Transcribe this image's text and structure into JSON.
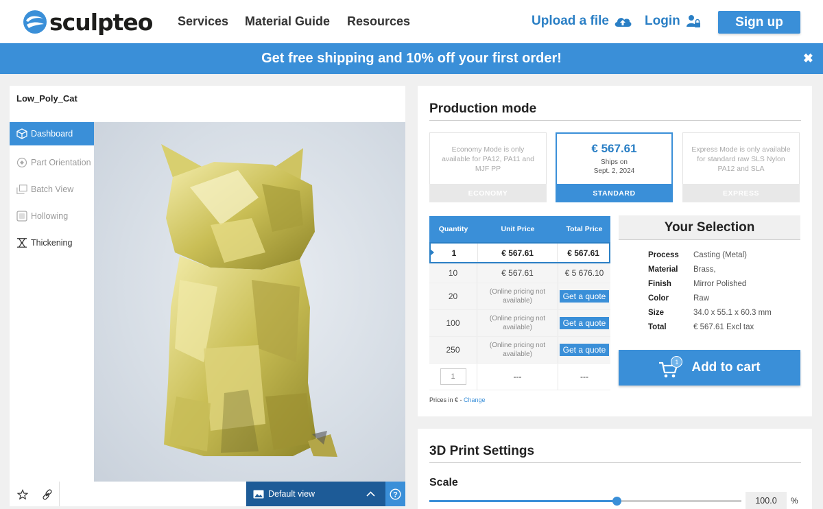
{
  "brand": {
    "name": "sculpteo",
    "color": "#3a8fd8"
  },
  "nav": {
    "items": [
      "Services",
      "Material Guide",
      "Resources"
    ],
    "upload_label": "Upload a file",
    "login_label": "Login",
    "signup_label": "Sign up"
  },
  "promo": {
    "text": "Get free shipping and 10% off your first order!",
    "close": "✖"
  },
  "part": {
    "name": "Low_Poly_Cat"
  },
  "sidebar": {
    "items": [
      {
        "label": "Dashboard",
        "icon": "cube-icon"
      },
      {
        "label": "Part Orientation",
        "icon": "orientation-icon"
      },
      {
        "label": "Batch View",
        "icon": "batch-icon"
      },
      {
        "label": "Hollowing",
        "icon": "hollowing-icon"
      },
      {
        "label": "Thickening",
        "icon": "thickening-icon"
      }
    ]
  },
  "viewer": {
    "view_label": "Default view",
    "help": "?"
  },
  "production": {
    "title": "Production mode",
    "modes": [
      {
        "label": "ECONOMY",
        "note": "Economy Mode is only available for PA12, PA11 and MJF PP"
      },
      {
        "label": "STANDARD",
        "price": "€ 567.61",
        "ships_label": "Ships on",
        "ships_date": "Sept. 2, 2024",
        "selected": true
      },
      {
        "label": "EXPRESS",
        "note": "Express Mode is only available for standard raw SLS Nylon PA12 and SLA"
      }
    ]
  },
  "pricing": {
    "headers": {
      "quantity": "Quantity",
      "unit": "Unit Price",
      "total": "Total Price"
    },
    "rows": [
      {
        "qty": "1",
        "unit": "€ 567.61",
        "total": "€ 567.61"
      },
      {
        "qty": "10",
        "unit": "€ 567.61",
        "total": "€ 5 676.10"
      },
      {
        "qty": "20",
        "unit": "(Online pricing not available)",
        "total": "Get a quote"
      },
      {
        "qty": "100",
        "unit": "(Online pricing not available)",
        "total": "Get a quote"
      },
      {
        "qty": "250",
        "unit": "(Online pricing not available)",
        "total": "Get a quote"
      }
    ],
    "custom": {
      "qty": "1",
      "unit": "---",
      "total": "---"
    },
    "note": "Prices in € - ",
    "change": "Change"
  },
  "selection": {
    "title": "Your Selection",
    "rows": [
      {
        "key": "Process",
        "value": "Casting (Metal)"
      },
      {
        "key": "Material",
        "value": "Brass,"
      },
      {
        "key": "Finish",
        "value": "Mirror Polished"
      },
      {
        "key": "Color",
        "value": "Raw"
      },
      {
        "key": "Size",
        "value": "34.0 x 55.1 x 60.3 mm"
      },
      {
        "key": "Total",
        "value": "€ 567.61 Excl tax"
      }
    ],
    "cart_count": "1",
    "add_to_cart": "Add to cart"
  },
  "settings": {
    "title": "3D Print Settings",
    "scale_label": "Scale",
    "scale_value": "100.0",
    "scale_unit": "%",
    "slider_fraction": 0.6
  }
}
